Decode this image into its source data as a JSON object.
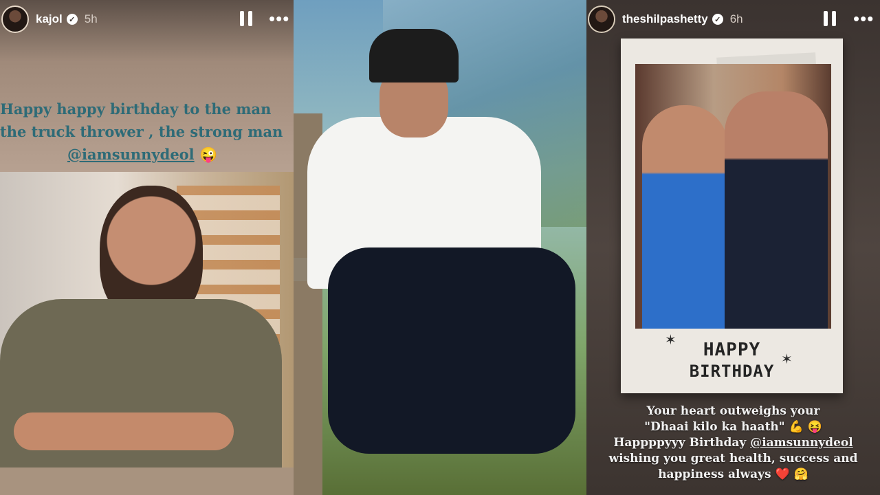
{
  "panel1": {
    "username": "kajol",
    "time": "5h",
    "verified_icon": "verified-badge-icon",
    "greeting_lines": [
      "Happy happy birthday to the man",
      "the truck thrower , the strong man"
    ],
    "mention": "@iamsunnydeol",
    "emoji": "😜"
  },
  "panel3": {
    "username": "theshilpashetty",
    "time": "6h",
    "verified_icon": "verified-badge-icon",
    "card_line1": "HAPPY",
    "card_line2": "BIRTHDAY",
    "caption_lines": [
      "Your heart outweighs your",
      "\"Dhaai kilo ka haath\"",
      "Happppyyy Birthday",
      "wishing you great health, success and",
      "happiness always"
    ],
    "mention": "@iamsunnydeol",
    "emoji_1": "💪",
    "emoji_2": "😝",
    "emoji_3": "❤️",
    "emoji_4": "🤗"
  },
  "icons": [
    "pause-icon",
    "more-icon",
    "verified-badge-icon"
  ]
}
